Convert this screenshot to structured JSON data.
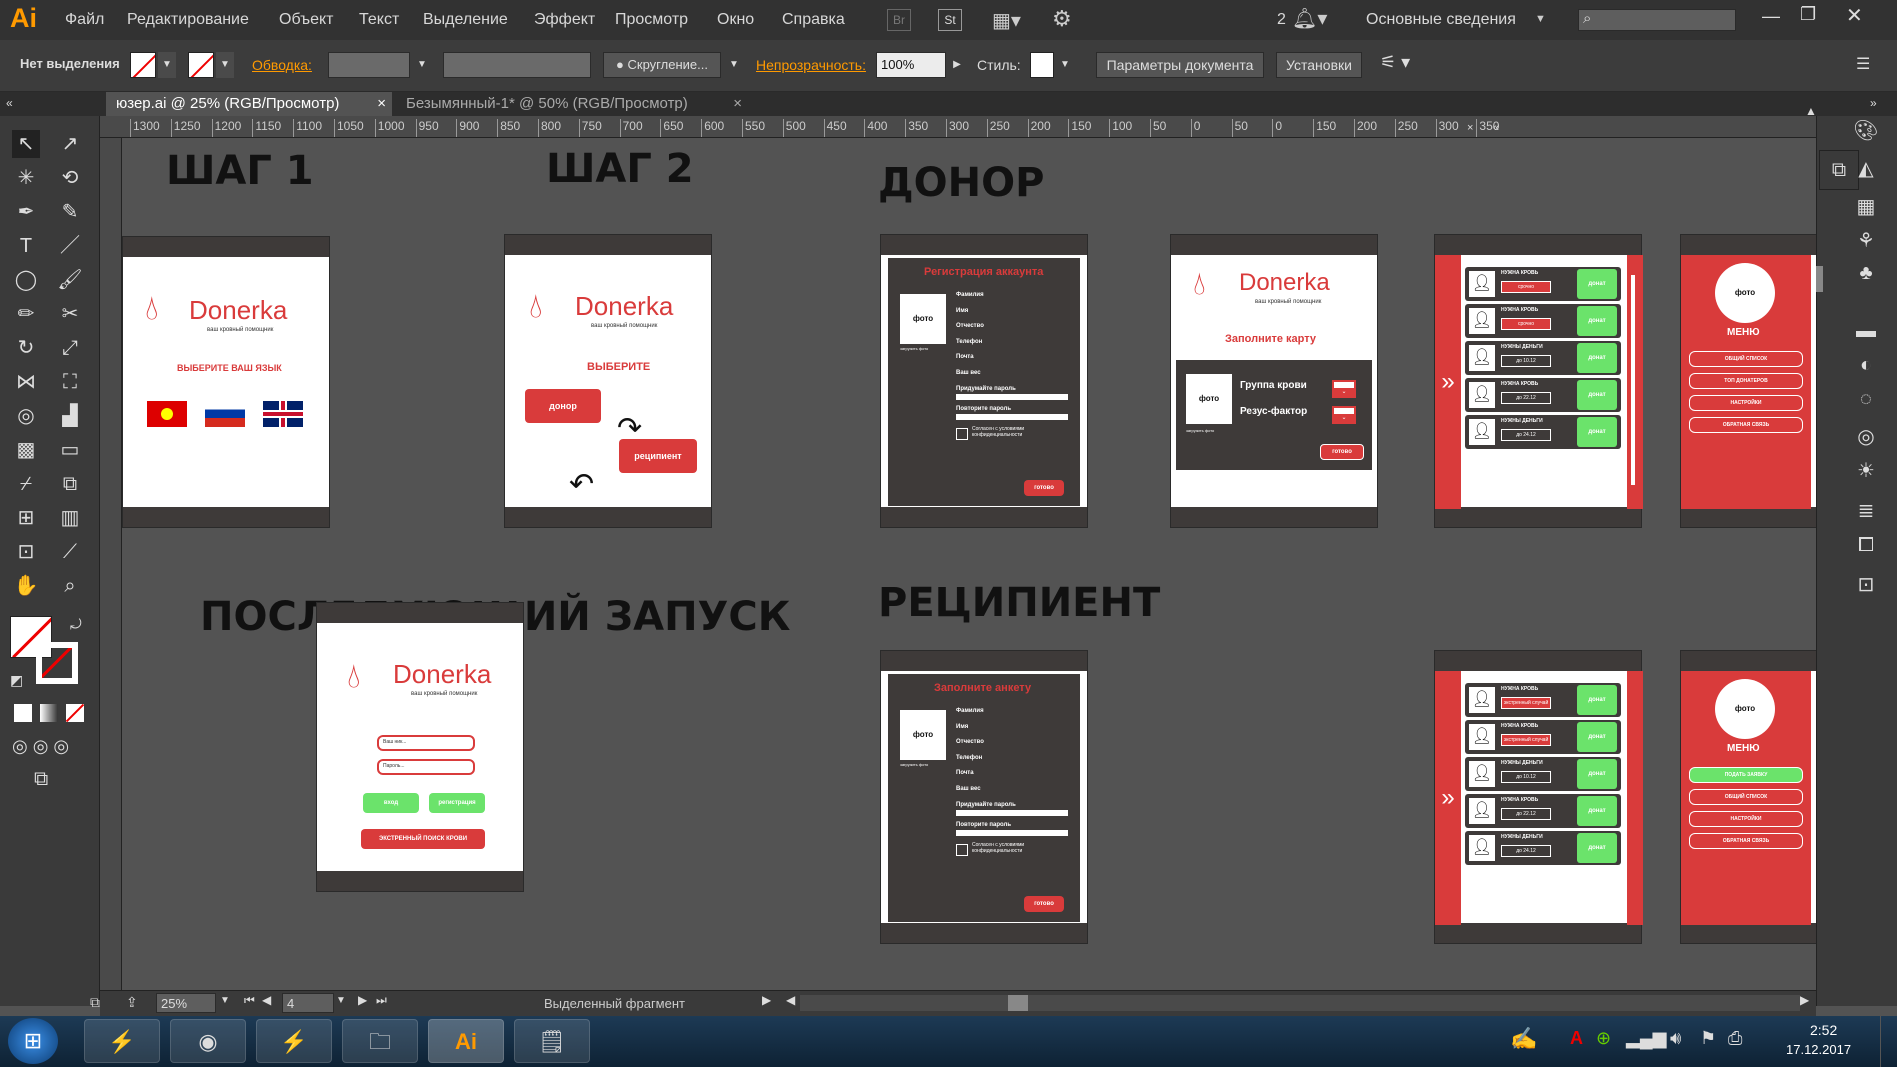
{
  "app": {
    "logo": "Ai"
  },
  "menu": [
    "Файл",
    "Редактирование",
    "Объект",
    "Текст",
    "Выделение",
    "Эффект",
    "Просмотр",
    "Окно",
    "Справка"
  ],
  "menubar_right": {
    "bridge": "Br",
    "stock": "St",
    "notif_count": "2",
    "workspace": "Основные сведения",
    "search_placeholder": ""
  },
  "control": {
    "selection": "Нет выделения",
    "stroke_label": "Обводка:",
    "variable_width": "Скругление...",
    "opacity_label": "Непрозрачность:",
    "opacity_value": "100%",
    "style_label": "Стиль:",
    "doc_settings": "Параметры документа",
    "prefs": "Установки"
  },
  "tabs": [
    "юзер.ai @ 25% (RGB/Просмотр)",
    "Безымянный-1* @ 50% (RGB/Просмотр)"
  ],
  "ruler_ticks": [
    "1300",
    "1250",
    "1200",
    "1150",
    "1100",
    "1050",
    "1000",
    "950",
    "900",
    "850",
    "800",
    "750",
    "700",
    "650",
    "600",
    "550",
    "500",
    "450",
    "400",
    "350",
    "300",
    "250",
    "200",
    "150",
    "100",
    "50",
    "0",
    "50",
    "0",
    "150",
    "200",
    "250",
    "300",
    "350"
  ],
  "headings": {
    "step1": "ШАГ 1",
    "step2": "ШАГ 2",
    "donor": "ДОНОР",
    "next_launch": "ПОСЛЕДУЮЩИЙ ЗАПУСК",
    "recipient": "РЕЦИПИЕНТ"
  },
  "boards": {
    "brand": "Donerka",
    "brand_sub": "ваш кровный помощник",
    "choose_lang": "ВЫБЕРИТЕ ВАШ ЯЗЫК",
    "choose": "ВЫБЕРИТЕ",
    "donor_btn": "донор",
    "recipient_btn": "реципиент",
    "reg_title": "Регистрация аккаунта",
    "photo": "фото",
    "photo_upload": "загрузить фото",
    "fields": [
      "Фамилия",
      "Имя",
      "Отчество",
      "Телефон",
      "Почта",
      "Ваш вес"
    ],
    "pass1": "Придумайте пароль",
    "pass2": "Повторите пароль",
    "agree": "Согласен с условиями конфиденциальности",
    "ready": "готово",
    "fill_card": "Заполните карту",
    "blood_group": "Группа крови",
    "rh_factor": "Резус-фактор",
    "fill_form": "Заполните анкету",
    "list_items": [
      "НУЖНА КРОВЬ",
      "НУЖНА КРОВЬ",
      "НУЖНЫ ДЕНЬГИ",
      "НУЖНА КРОВЬ",
      "НУЖНЫ ДЕНЬГИ"
    ],
    "list_tags": [
      "срочно",
      "срочно",
      "до 10.12",
      "до 22.12",
      "до 24.12"
    ],
    "list_tags_r": [
      "экстренный случай",
      "экстренный случай",
      "до 10.12",
      "до 22.12",
      "до 24.12"
    ],
    "help_btn": "помочь",
    "donate_btn": "донат",
    "menu_title": "МЕНЮ",
    "menu_items": [
      "ОБЩИЙ СПИСОК",
      "ТОП ДОНАТЕРОВ",
      "НАСТРОЙКИ",
      "ОБРАТНАЯ СВЯЗЬ"
    ],
    "menu_items_r": [
      "ПОДАТЬ ЗАЯВКУ",
      "ОБЩИЙ СПИСОК",
      "НАСТРОЙКИ",
      "ОБРАТНАЯ СВЯЗЬ"
    ],
    "login": "Ваш ник...",
    "password": "Пароль...",
    "enter": "вход",
    "register": "регистрация",
    "emergency": "ЭКСТРЕННЫЙ ПОИСК КРОВИ"
  },
  "status": {
    "zoom": "25%",
    "page": "4",
    "tool": "Выделенный фрагмент"
  },
  "taskbar": {
    "time": "2:52",
    "date": "17.12.2017"
  },
  "colors": {
    "accent": "#d93b3b",
    "green": "#6be36b",
    "dark": "#3e3a39",
    "ai_orange": "#ff9a00"
  }
}
